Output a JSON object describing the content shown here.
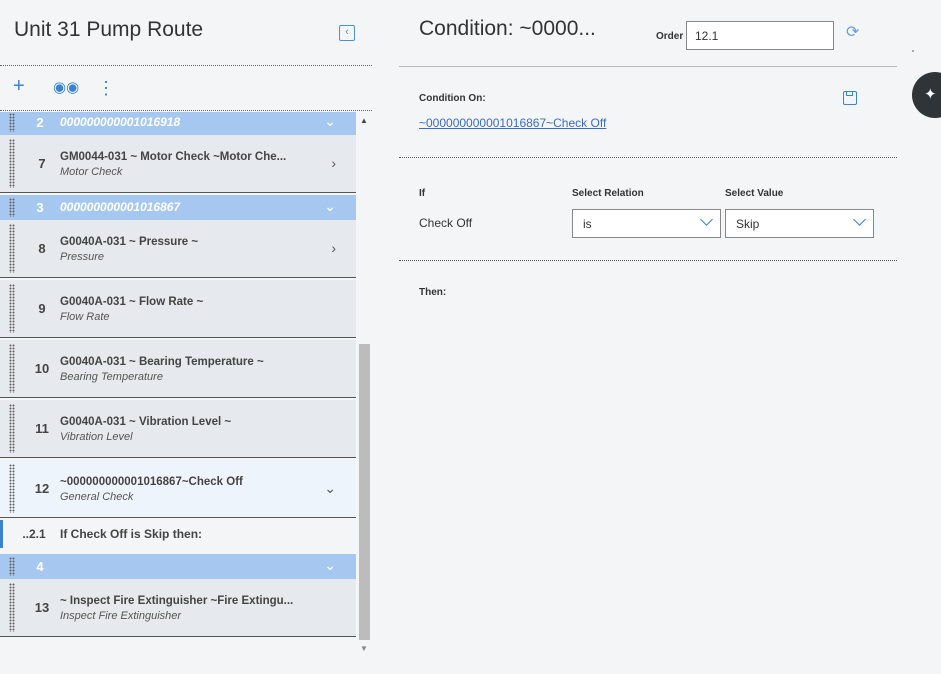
{
  "left_panel": {
    "title": "Unit 31 Pump Route",
    "toolbar": {
      "add_icon": "plus-icon",
      "find_icon": "binoculars-icon",
      "more_icon": "kebab-icon"
    },
    "rows": [
      {
        "type": "group",
        "number": "2",
        "title": "000000000001016918"
      },
      {
        "type": "item",
        "number": "7",
        "title": "GM0044-031 ~ Motor Check ~Motor Che...",
        "subtitle": "Motor Check",
        "chevron": "right"
      },
      {
        "type": "group",
        "number": "3",
        "title": "000000000001016867"
      },
      {
        "type": "item",
        "number": "8",
        "title": "G0040A-031 ~ Pressure ~",
        "subtitle": "Pressure",
        "chevron": "right"
      },
      {
        "type": "item",
        "number": "9",
        "title": "G0040A-031 ~ Flow Rate ~",
        "subtitle": "Flow Rate"
      },
      {
        "type": "item",
        "number": "10",
        "title": "G0040A-031 ~ Bearing Temperature ~",
        "subtitle": "Bearing Temperature"
      },
      {
        "type": "item",
        "number": "11",
        "title": "G0040A-031 ~ Vibration Level ~",
        "subtitle": "Vibration Level"
      },
      {
        "type": "item",
        "number": "12",
        "title": "~000000000001016867~Check Off",
        "subtitle": "General Check",
        "chevron": "down",
        "active": true
      },
      {
        "type": "condition",
        "number": "..2.1",
        "text": "If Check Off is Skip then:"
      },
      {
        "type": "group",
        "number": "4",
        "title": ""
      },
      {
        "type": "item",
        "number": "13",
        "title": "~ Inspect Fire Extinguisher ~Fire Extingu...",
        "subtitle": "Inspect Fire Extinguisher"
      }
    ]
  },
  "right_panel": {
    "title": "Condition: ~0000...",
    "order_label": "Order",
    "order_value": "12.1",
    "condition_on_label": "Condition On:",
    "condition_on_link": "~000000000001016867~Check Off",
    "if_label": "If",
    "select_relation_label": "Select Relation",
    "select_value_label": "Select Value",
    "field_name": "Check Off",
    "relation_value": "is",
    "value_value": "Skip",
    "then_label": "Then:"
  },
  "colors": {
    "accent": "#3b82d0",
    "group_row": "#a6c8f0",
    "item_row": "#e6e9ed",
    "active_row": "#eef4fc",
    "pin_bg": "#2f3438"
  }
}
